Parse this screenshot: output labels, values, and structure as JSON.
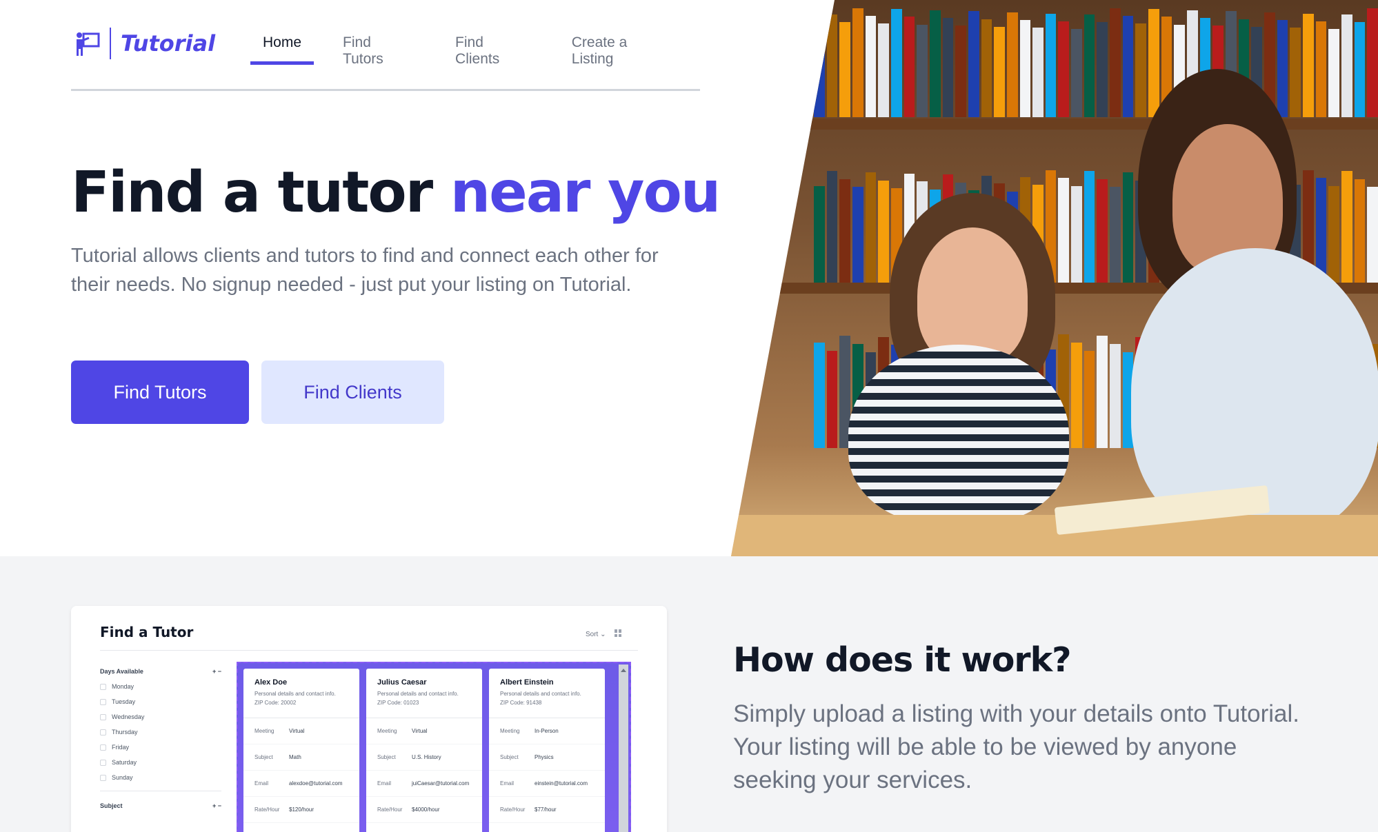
{
  "brand": {
    "name": "Tutorial",
    "icon": "teacher-board-icon",
    "accent": "#4f46e5"
  },
  "nav": {
    "items": [
      {
        "label": "Home",
        "active": true
      },
      {
        "label": "Find Tutors",
        "active": false
      },
      {
        "label": "Find Clients",
        "active": false
      },
      {
        "label": "Create a Listing",
        "active": false
      }
    ]
  },
  "hero": {
    "title_main": "Find a tutor ",
    "title_accent": "near you",
    "description": "Tutorial allows clients and tutors to find and connect each other for their needs. No signup needed - just put your listing on Tutorial.",
    "primary_button": "Find Tutors",
    "secondary_button": "Find Clients"
  },
  "preview": {
    "title": "Find a Tutor",
    "sort_label": "Sort",
    "filter_days_label": "Days Available",
    "days": [
      "Monday",
      "Tuesday",
      "Wednesday",
      "Thursday",
      "Friday",
      "Saturday",
      "Sunday"
    ],
    "filter_subject_label": "Subject",
    "filter_controls": "+ −",
    "cards": [
      {
        "name": "Alex Doe",
        "subtitle": "Personal details and contact info.",
        "zip": "ZIP Code: 20002",
        "rows": [
          {
            "k": "Meeting",
            "v": "Virtual"
          },
          {
            "k": "Subject",
            "v": "Math"
          },
          {
            "k": "Email",
            "v": "alexdoe@tutorial.com"
          },
          {
            "k": "Rate/Hour",
            "v": "$120/hour"
          }
        ]
      },
      {
        "name": "Julius Caesar",
        "subtitle": "Personal details and contact info.",
        "zip": "ZIP Code: 01023",
        "rows": [
          {
            "k": "Meeting",
            "v": "Virtual"
          },
          {
            "k": "Subject",
            "v": "U.S. History"
          },
          {
            "k": "Email",
            "v": "juiCaesar@tutorial.com"
          },
          {
            "k": "Rate/Hour",
            "v": "$4000/hour"
          }
        ]
      },
      {
        "name": "Albert Einstein",
        "subtitle": "Personal details and contact info.",
        "zip": "ZIP Code: 91438",
        "rows": [
          {
            "k": "Meeting",
            "v": "In-Person"
          },
          {
            "k": "Subject",
            "v": "Physics"
          },
          {
            "k": "Email",
            "v": "einstein@tutorial.com"
          },
          {
            "k": "Rate/Hour",
            "v": "$77/hour"
          }
        ]
      }
    ]
  },
  "how": {
    "title": "How does it work?",
    "text": "Simply upload a listing with your details onto Tutorial. Your listing will be able to be viewed by anyone seeking your services."
  }
}
